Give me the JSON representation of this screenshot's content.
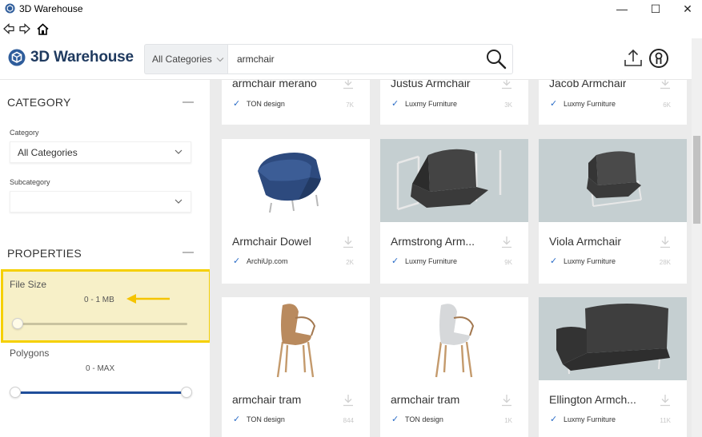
{
  "window": {
    "title": "3D Warehouse",
    "controls": {
      "minimize": "—",
      "maximize": "☐",
      "close": "✕"
    }
  },
  "header": {
    "brand": "3D Warehouse",
    "category_select": "All Categories",
    "search_value": "armchair",
    "search_placeholder": ""
  },
  "sidebar": {
    "category_section": "CATEGORY",
    "category_label": "Category",
    "category_value": "All Categories",
    "subcategory_label": "Subcategory",
    "subcategory_value": "",
    "properties_section": "PROPERTIES",
    "filesize": {
      "label": "File Size",
      "range": "0 - 1 MB",
      "highlight_color": "#f5d000"
    },
    "polygons": {
      "label": "Polygons",
      "range": "0 - MAX"
    }
  },
  "grid": {
    "cards": [
      {
        "title": "armchair merano",
        "author": "TON design",
        "downloads": "7K",
        "thumb": "none"
      },
      {
        "title": "Justus Armchair",
        "author": "Luxmy Furniture",
        "downloads": "3K",
        "thumb": "none"
      },
      {
        "title": "Jacob Armchair",
        "author": "Luxmy Furniture",
        "downloads": "6K",
        "thumb": "none"
      },
      {
        "title": "Armchair Dowel",
        "author": "ArchiUp.com",
        "downloads": "2K",
        "thumb": "blue-armchair"
      },
      {
        "title": "Armstrong Arm...",
        "author": "Luxmy Furniture",
        "downloads": "9K",
        "thumb": "chrome-armchair"
      },
      {
        "title": "Viola Armchair",
        "author": "Luxmy Furniture",
        "downloads": "28K",
        "thumb": "gray-armchair"
      },
      {
        "title": "armchair tram",
        "author": "TON design",
        "downloads": "844",
        "thumb": "wood-chair"
      },
      {
        "title": "armchair tram",
        "author": "TON design",
        "downloads": "1K",
        "thumb": "white-wood-chair"
      },
      {
        "title": "Ellington Armch...",
        "author": "Luxmy Furniture",
        "downloads": "11K",
        "thumb": "dark-armchair"
      }
    ]
  },
  "colors": {
    "brand": "#1f3a5f",
    "accent_blue": "#2a6cc7",
    "slider_blue": "#1f4e9a",
    "highlight_yellow": "#f5d000",
    "highlight_bg": "#f7f0c8"
  }
}
